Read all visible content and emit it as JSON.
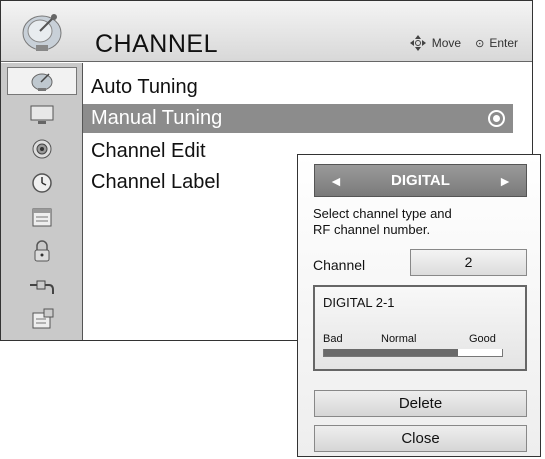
{
  "header": {
    "title": "CHANNEL",
    "hint_move": "Move",
    "hint_enter": "Enter",
    "icon": "satellite-dish-icon"
  },
  "sidebar": {
    "icons": [
      "satellite-dish-icon",
      "monitor-icon",
      "speaker-icon",
      "clock-icon",
      "calendar-icon",
      "lock-icon",
      "input-plug-icon",
      "settings-icon"
    ],
    "active_index": 0
  },
  "menu": {
    "items": [
      {
        "label": "Auto Tuning"
      },
      {
        "label": "Manual Tuning"
      },
      {
        "label": "Channel Edit"
      },
      {
        "label": "Channel Label"
      }
    ],
    "selected_index": 1
  },
  "dialog": {
    "type": "DIGITAL",
    "left_arrow": "◄",
    "right_arrow": "►",
    "instruction_line1": "Select channel type and",
    "instruction_line2": "RF channel number.",
    "channel_label": "Channel",
    "channel_value": "2",
    "signal": {
      "name": "DIGITAL 2-1",
      "label_bad": "Bad",
      "label_normal": "Normal",
      "label_good": "Good",
      "level": 0.75
    },
    "delete_label": "Delete",
    "close_label": "Close"
  },
  "colors": {
    "selected_bg": "#8c8c8c",
    "sidebar_bg": "#c9c9c9",
    "type_bar_bg": "#8a8a8a"
  }
}
